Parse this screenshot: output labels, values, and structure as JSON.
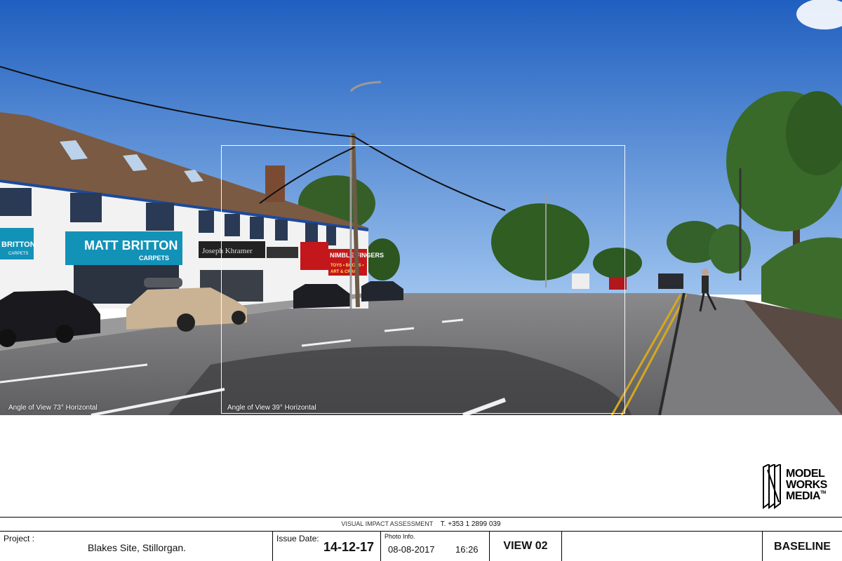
{
  "photo": {
    "aov_outer_label": "Angle of View 73° Horizontal",
    "aov_inner_label": "Angle of View 39° Horizontal",
    "shop_signs": {
      "matt_britton": "MATT BRITTON",
      "carpets": "CARPETS",
      "britton_partial": "BRITTON",
      "britton_partial_sub": "CARPETS",
      "joseph_khramer": "Joseph Khramer",
      "nimble_fingers": "NIMBLE FINGERS",
      "toys_books": "TOYS • BOOKS •",
      "art_craft": "ART & CRAFT"
    }
  },
  "logo": {
    "line1": "MODEL",
    "line2": "WORKS",
    "line3": "MEDIA",
    "tm": "TM"
  },
  "subtitle": {
    "text": "VISUAL IMPACT ASSESSMENT",
    "phone": "T. +353 1 2899 039"
  },
  "titleblock": {
    "project_label": "Project :",
    "project_value": "Blakes Site, Stillorgan.",
    "issue_label": "Issue Date:",
    "issue_value": "14-12-17",
    "photo_label": "Photo Info.",
    "photo_date": "08-08-2017",
    "photo_time": "16:26",
    "view": "VIEW 02",
    "status": "BASELINE"
  },
  "colors": {
    "sky_top": "#1f5fbf",
    "sky_bottom": "#8fb8ea",
    "road": "#6e6e70",
    "shop_teal": "#1392b8",
    "roof": "#7a5a42",
    "foliage": "#2f5d22",
    "road_line_yellow": "#d6a81e"
  }
}
